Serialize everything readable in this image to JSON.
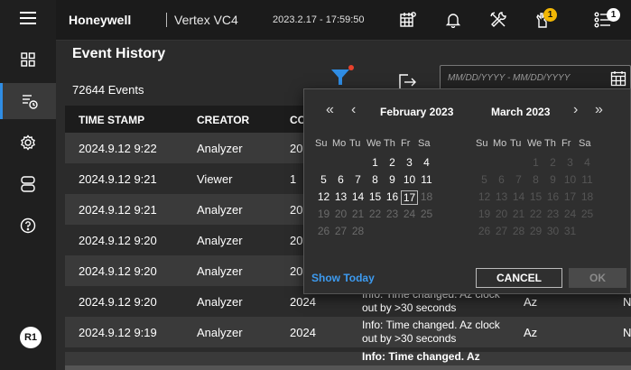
{
  "header": {
    "brand": "Honeywell",
    "product": "Vertex VC4",
    "datetime": "2023.2.17 - 17:59:50",
    "alarm_badge": "1",
    "menu_badge": "1"
  },
  "page": {
    "title": "Event History",
    "event_count": "72644 Events",
    "date_range_placeholder": "MM/DD/YYYY - MM/DD/YYYY"
  },
  "table": {
    "columns": [
      "TIME STAMP",
      "CREATOR",
      "CO"
    ],
    "rows": [
      {
        "time": "2024.9.12 9:22",
        "creator": "Analyzer",
        "c3": "20"
      },
      {
        "time": "2024.9.12 9:21",
        "creator": "Viewer",
        "c3": "1"
      },
      {
        "time": "2024.9.12 9:21",
        "creator": "Analyzer",
        "c3": "20"
      },
      {
        "time": "2024.9.12 9:20",
        "creator": "Analyzer",
        "c3": "20"
      },
      {
        "time": "2024.9.12 9:20",
        "creator": "Analyzer",
        "c3": "20"
      },
      {
        "time": "2024.9.12 9:20",
        "creator": "Analyzer",
        "c3": "2024",
        "desc": "Info: Time changed. Az clock out by >30 seconds",
        "c5": "Az",
        "c6": "N"
      },
      {
        "time": "2024.9.12 9:19",
        "creator": "Analyzer",
        "c3": "2024",
        "desc": "Info: Time changed. Az clock out by >30 seconds",
        "c5": "Az",
        "c6": "N"
      }
    ],
    "partial_row_desc": "Info: Time changed. Az"
  },
  "picker": {
    "prev_year": "«",
    "prev_month": "‹",
    "next_month": "›",
    "next_year": "»",
    "left_month": "February 2023",
    "right_month": "March 2023",
    "weekdays": [
      "Su",
      "Mo",
      "Tu",
      "We",
      "Th",
      "Fr",
      "Sa"
    ],
    "feb_weeks": [
      [
        "",
        "",
        "",
        "1",
        "2",
        "3",
        "4"
      ],
      [
        "5",
        "6",
        "7",
        "8",
        "9",
        "10",
        "11"
      ],
      [
        "12",
        "13",
        "14",
        "15",
        "16",
        "17",
        "18"
      ],
      [
        "19",
        "20",
        "21",
        "22",
        "23",
        "24",
        "25"
      ],
      [
        "26",
        "27",
        "28",
        "",
        "",
        "",
        ""
      ]
    ],
    "mar_weeks": [
      [
        "",
        "",
        "",
        "1",
        "2",
        "3",
        "4"
      ],
      [
        "5",
        "6",
        "7",
        "8",
        "9",
        "10",
        "11"
      ],
      [
        "12",
        "13",
        "14",
        "15",
        "16",
        "17",
        "18"
      ],
      [
        "19",
        "20",
        "21",
        "22",
        "23",
        "24",
        "25"
      ],
      [
        "26",
        "27",
        "28",
        "29",
        "30",
        "31",
        ""
      ]
    ],
    "today": "17",
    "show_today": "Show Today",
    "cancel": "CANCEL",
    "ok": "OK"
  },
  "rail": {
    "avatar": "R1"
  },
  "colors": {
    "accent_blue": "#2f8de4",
    "badge_yellow": "#f2b705",
    "filter_dot": "#e8412c"
  }
}
